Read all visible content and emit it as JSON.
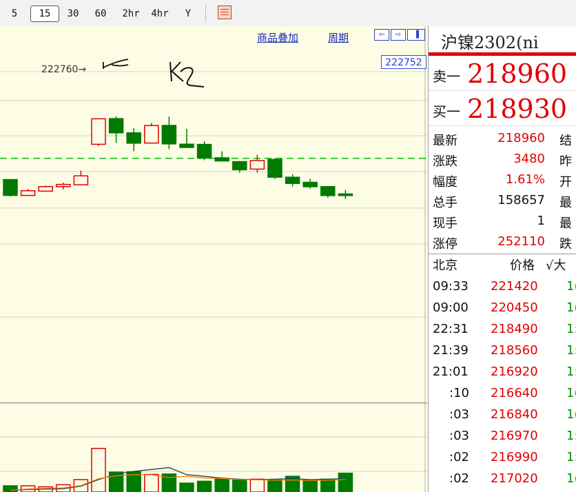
{
  "toolbar": {
    "timeframes": [
      {
        "label": "5",
        "active": false
      },
      {
        "label": "15",
        "active": true
      },
      {
        "label": "30",
        "active": false
      },
      {
        "label": "60",
        "active": false
      },
      {
        "label": "2hr",
        "active": false
      },
      {
        "label": "4hr",
        "active": false
      },
      {
        "label": "Y",
        "active": false
      }
    ],
    "grid_icon": "grid-icon"
  },
  "chart": {
    "links": {
      "overlay": "商品叠加",
      "period": "周期"
    },
    "nav_icons": [
      "scroll-left-icon",
      "scroll-right-icon",
      "panel-toggle-icon"
    ],
    "price_tag": "222752",
    "high_label": "222760",
    "annotations": [
      "K1",
      "K2"
    ],
    "colors": {
      "up": "#e00000",
      "down": "#007a00",
      "ma_short": "#f08000",
      "ma_long": "#2a4050",
      "dash": "#00c000"
    }
  },
  "chart_data": {
    "type": "candlestick",
    "price_candles": [
      {
        "open": 222070,
        "close": 220920,
        "high": 222060,
        "low": 220850
      },
      {
        "open": 220920,
        "close": 221260,
        "high": 221390,
        "low": 220920
      },
      {
        "open": 221230,
        "close": 221560,
        "high": 221640,
        "low": 221190
      },
      {
        "open": 221560,
        "close": 221720,
        "high": 221850,
        "low": 221360
      },
      {
        "open": 221690,
        "close": 222340,
        "high": 222720,
        "low": 221690
      },
      {
        "open": 224630,
        "close": 226480,
        "high": 226530,
        "low": 224520
      },
      {
        "open": 226490,
        "close": 225460,
        "high": 226650,
        "low": 224730
      },
      {
        "open": 225460,
        "close": 224710,
        "high": 225800,
        "low": 224130
      },
      {
        "open": 224720,
        "close": 225990,
        "high": 226170,
        "low": 224710
      },
      {
        "open": 226000,
        "close": 224660,
        "high": 226640,
        "low": 224280
      },
      {
        "open": 224640,
        "close": 224400,
        "high": 225750,
        "low": 224380
      },
      {
        "open": 224620,
        "close": 223630,
        "high": 224850,
        "low": 223470
      },
      {
        "open": 223650,
        "close": 223420,
        "high": 224120,
        "low": 223390
      },
      {
        "open": 223370,
        "close": 222780,
        "high": 223430,
        "low": 222580
      },
      {
        "open": 222830,
        "close": 223450,
        "high": 223870,
        "low": 222580
      },
      {
        "open": 223530,
        "close": 222240,
        "high": 223620,
        "low": 222100
      },
      {
        "open": 222240,
        "close": 221790,
        "high": 222450,
        "low": 221560
      },
      {
        "open": 221870,
        "close": 221550,
        "high": 222120,
        "low": 221420
      },
      {
        "open": 221560,
        "close": 220910,
        "high": 221610,
        "low": 220760
      },
      {
        "open": 221030,
        "close": 220910,
        "high": 221310,
        "low": 220650
      }
    ],
    "volume_bars": [
      {
        "value": 300,
        "up": false
      },
      {
        "value": 300,
        "up": true
      },
      {
        "value": 250,
        "up": true
      },
      {
        "value": 350,
        "up": true
      },
      {
        "value": 600,
        "up": true
      },
      {
        "value": 2110,
        "up": true
      },
      {
        "value": 960,
        "up": false
      },
      {
        "value": 980,
        "up": false
      },
      {
        "value": 850,
        "up": true
      },
      {
        "value": 870,
        "up": false
      },
      {
        "value": 430,
        "up": false
      },
      {
        "value": 520,
        "up": false
      },
      {
        "value": 620,
        "up": false
      },
      {
        "value": 590,
        "up": false
      },
      {
        "value": 620,
        "up": true
      },
      {
        "value": 590,
        "up": false
      },
      {
        "value": 760,
        "up": false
      },
      {
        "value": 590,
        "up": false
      },
      {
        "value": 620,
        "up": false
      },
      {
        "value": 910,
        "up": false
      }
    ],
    "volume_ma_short": [
      80,
      150,
      180,
      200,
      310,
      640,
      790,
      840,
      830,
      700,
      760,
      680,
      650,
      600,
      590,
      570,
      580,
      560,
      570,
      600
    ],
    "volume_ma_long": [
      70,
      120,
      140,
      160,
      280,
      600,
      860,
      1000,
      1090,
      1180,
      840,
      760,
      670,
      620,
      590,
      620,
      650,
      600,
      620,
      650
    ],
    "dashed_level": 223610
  },
  "quote": {
    "title": "沪镍2302(ni",
    "sell1": {
      "label": "卖一",
      "price": "218960"
    },
    "buy1": {
      "label": "买一",
      "price": "218930"
    },
    "stats": [
      {
        "label": "最新",
        "value": "218960",
        "color": "#e00000",
        "label2": "结"
      },
      {
        "label": "涨跌",
        "value": "3480",
        "color": "#e00000",
        "label2": "昨"
      },
      {
        "label": "幅度",
        "value": "1.61%",
        "color": "#e00000",
        "label2": "开"
      },
      {
        "label": "总手",
        "value": "158657",
        "color": "#111111",
        "label2": "最"
      },
      {
        "label": "现手",
        "value": "1",
        "color": "#111111",
        "label2": "最"
      },
      {
        "label": "涨停",
        "value": "252110",
        "color": "#e00000",
        "label2": "跌"
      }
    ],
    "ticks_header": {
      "time": "北京",
      "price": "价格",
      "vol": "√大"
    },
    "ticks": [
      {
        "time": "09:33",
        "price": "221420",
        "vol": "1("
      },
      {
        "time": "09:00",
        "price": "220450",
        "vol": "1("
      },
      {
        "time": "22:31",
        "price": "218490",
        "vol": "1:"
      },
      {
        "time": "21:39",
        "price": "218560",
        "vol": "1:"
      },
      {
        "time": "21:01",
        "price": "216920",
        "vol": "1:"
      },
      {
        "time": ":10",
        "price": "216640",
        "vol": "1("
      },
      {
        "time": ":03",
        "price": "216840",
        "vol": "1("
      },
      {
        "time": ":03",
        "price": "216970",
        "vol": "1:"
      },
      {
        "time": ":02",
        "price": "216990",
        "vol": "1:"
      },
      {
        "time": ":02",
        "price": "217020",
        "vol": "1("
      }
    ]
  }
}
